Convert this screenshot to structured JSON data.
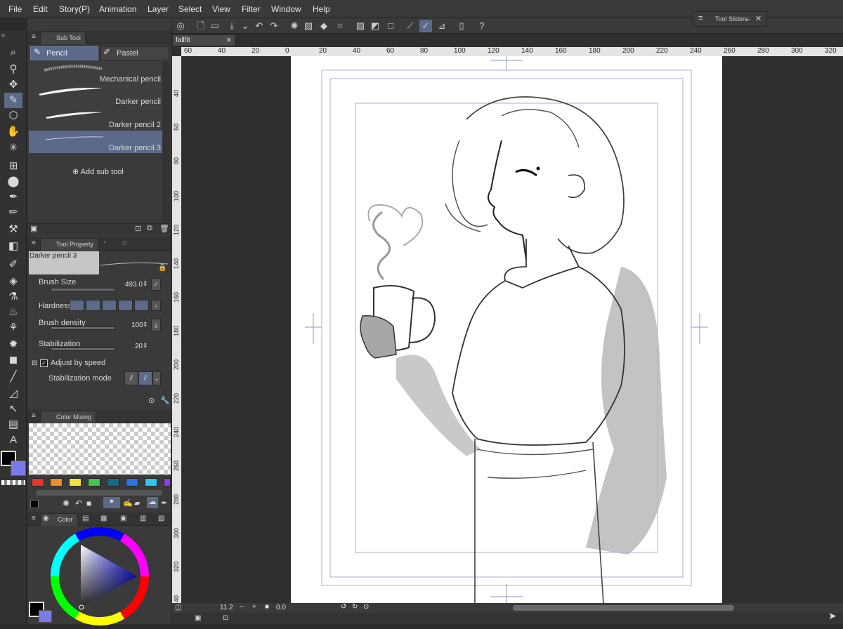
{
  "menu": [
    "File",
    "Edit",
    "Story(P)",
    "Animation",
    "Layer",
    "Select",
    "View",
    "Filter",
    "Window",
    "Help"
  ],
  "tool_sliders": {
    "title": "Tool Sliders"
  },
  "subtool": {
    "header": "Sub Tool",
    "tabs": [
      "Pencil",
      "Pastel"
    ],
    "items": [
      "Mechanical pencil",
      "Darker pencil",
      "Darker pencil 2",
      "Darker pencil 3"
    ],
    "add_label": "Add sub tool"
  },
  "tool_property": {
    "header": "Tool Property",
    "preset_name": "Darker pencil 3",
    "brush_size_label": "Brush Size",
    "brush_size_value": "493.0",
    "hardness_label": "Hardness",
    "brush_density_label": "Brush density",
    "brush_density_value": "100",
    "stabilization_label": "Stabilization",
    "stabilization_value": "20",
    "adjust_speed_label": "Adjust by speed",
    "stabilization_mode_label": "Stabilization mode"
  },
  "color_mixing": {
    "header": "Color Mixing"
  },
  "color_wheel": {
    "header": "Color"
  },
  "colors": {
    "swatches": [
      "#e8352e",
      "#ef8c2a",
      "#f2e23c",
      "#43c64d",
      "#156b82",
      "#2a75e6",
      "#2fc7ee",
      "#8a3fe8"
    ],
    "main": "#000000",
    "sub": "#7b7be8",
    "accent": "#5a6a88"
  },
  "document": {
    "tab_name": "fallfit"
  },
  "ruler_h": [
    "60",
    "40",
    "20",
    "0",
    "20",
    "40",
    "60",
    "80",
    "100",
    "120",
    "140",
    "160",
    "180",
    "200",
    "220",
    "240",
    "260",
    "280",
    "300",
    "320"
  ],
  "ruler_v": [
    "40",
    "60",
    "80",
    "100",
    "120",
    "140",
    "160",
    "180",
    "200",
    "220",
    "240",
    "260",
    "280",
    "300",
    "320",
    "40"
  ],
  "status": {
    "zoom": "11.2",
    "rotation": "0.0"
  }
}
